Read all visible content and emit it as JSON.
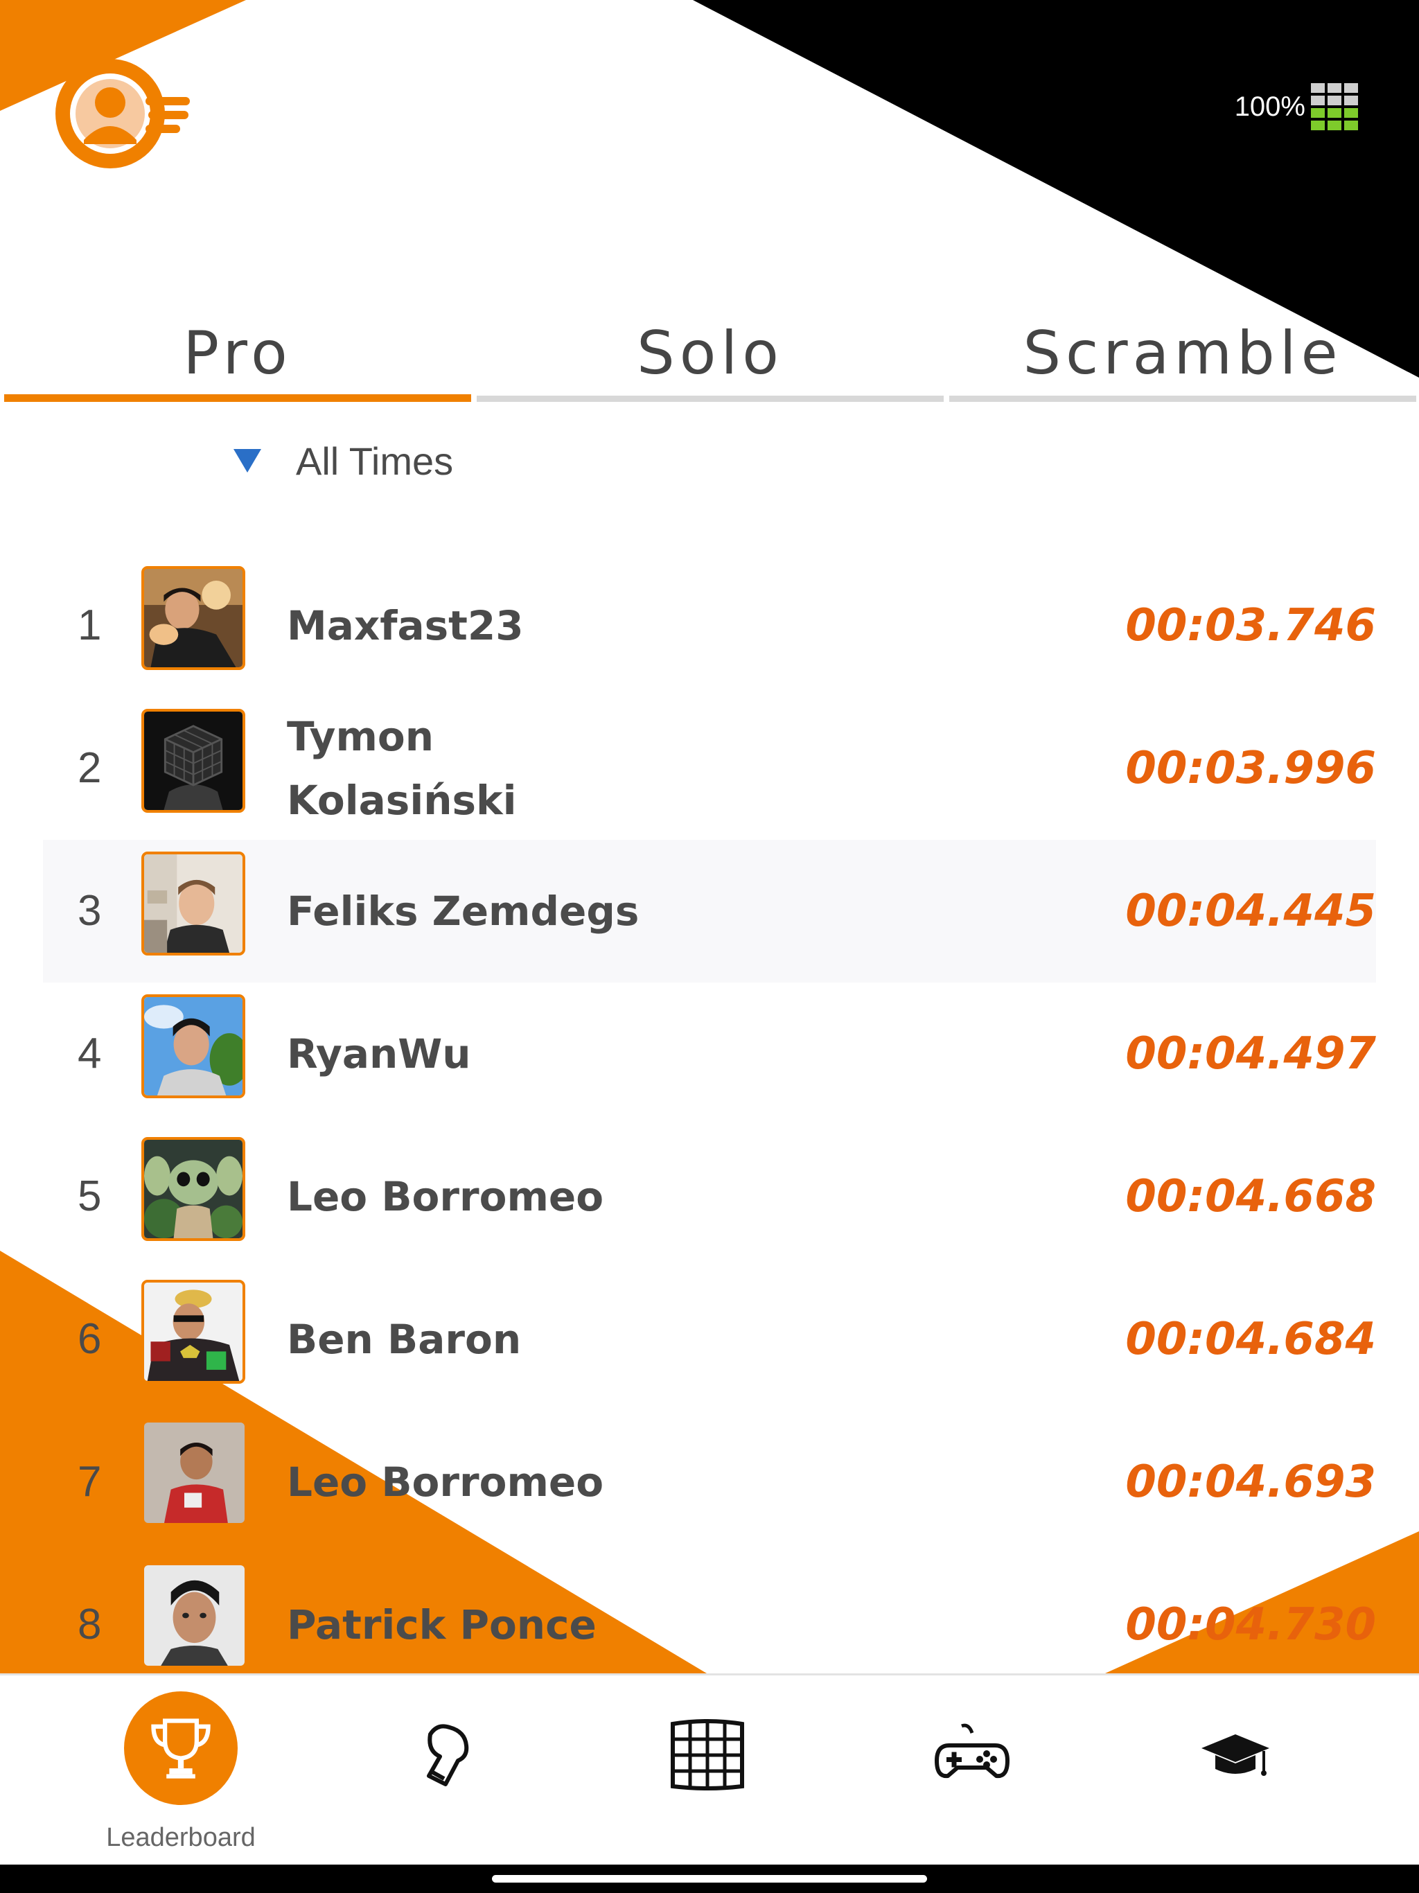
{
  "status": {
    "battery_text": "100%"
  },
  "header": {
    "profile_icon": "profile-icon"
  },
  "tabs": [
    {
      "label": "Pro",
      "active": true
    },
    {
      "label": "Solo",
      "active": false
    },
    {
      "label": "Scramble",
      "active": false
    }
  ],
  "filter": {
    "label": "All Times",
    "icon": "triangle-down-icon"
  },
  "leaderboard": {
    "rows": [
      {
        "rank": "1",
        "name": "Maxfast23",
        "time": "00:03.746"
      },
      {
        "rank": "2",
        "name": "Tymon Kolasiński",
        "time": "00:03.996"
      },
      {
        "rank": "3",
        "name": "Feliks Zemdegs",
        "time": "00:04.445"
      },
      {
        "rank": "4",
        "name": "RyanWu",
        "time": "00:04.497"
      },
      {
        "rank": "5",
        "name": "Leo Borromeo",
        "time": "00:04.668"
      },
      {
        "rank": "6",
        "name": "Ben Baron",
        "time": "00:04.684"
      },
      {
        "rank": "7",
        "name": "Leo Borromeo",
        "time": "00:04.693"
      },
      {
        "rank": "8",
        "name": "Patrick Ponce",
        "time": "00:04.730"
      }
    ]
  },
  "nav": {
    "items": [
      {
        "label": "Leaderboard",
        "icon": "trophy-icon",
        "active": true
      },
      {
        "label": "",
        "icon": "glove-icon",
        "active": false
      },
      {
        "label": "",
        "icon": "cube-icon",
        "active": false
      },
      {
        "label": "",
        "icon": "gamepad-icon",
        "active": false
      },
      {
        "label": "",
        "icon": "graduation-cap-icon",
        "active": false
      }
    ]
  },
  "colors": {
    "accent": "#f08000",
    "time": "#e8620c",
    "filter_arrow": "#2a6fc7",
    "battery_green": "#7ecb2b"
  }
}
